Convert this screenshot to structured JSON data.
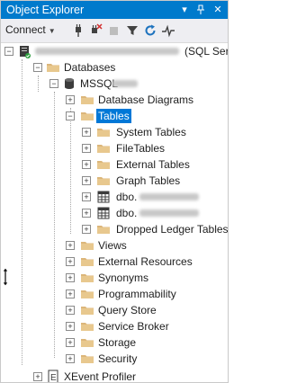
{
  "window": {
    "title": "Object Explorer",
    "controls": [
      "pin",
      "dropdown",
      "close"
    ]
  },
  "toolbar": {
    "connect_label": "Connect",
    "icons": [
      "connect-plug-icon",
      "disconnect-plug-icon",
      "stop-icon",
      "filter-icon",
      "refresh-icon",
      "activity-monitor-icon"
    ]
  },
  "tree": {
    "server_suffix": "(SQL Serv",
    "databases": "Databases",
    "db_prefix": "MSSQL",
    "items": {
      "diagrams": "Database Diagrams",
      "tables": "Tables",
      "system_tables": "System Tables",
      "file_tables": "FileTables",
      "external_tables": "External Tables",
      "graph_tables": "Graph Tables",
      "dbo1": "dbo.",
      "dbo2": "dbo.",
      "dropped_ledger": "Dropped Ledger Tables",
      "views": "Views",
      "external_resources": "External Resources",
      "synonyms": "Synonyms",
      "programmability": "Programmability",
      "query_store": "Query Store",
      "service_broker": "Service Broker",
      "storage": "Storage",
      "security": "Security",
      "xevent_profiler": "XEvent Profiler"
    }
  },
  "colors": {
    "title_bar": "#007acc",
    "selection": "#0078d7",
    "folder": "#dcb67a"
  }
}
